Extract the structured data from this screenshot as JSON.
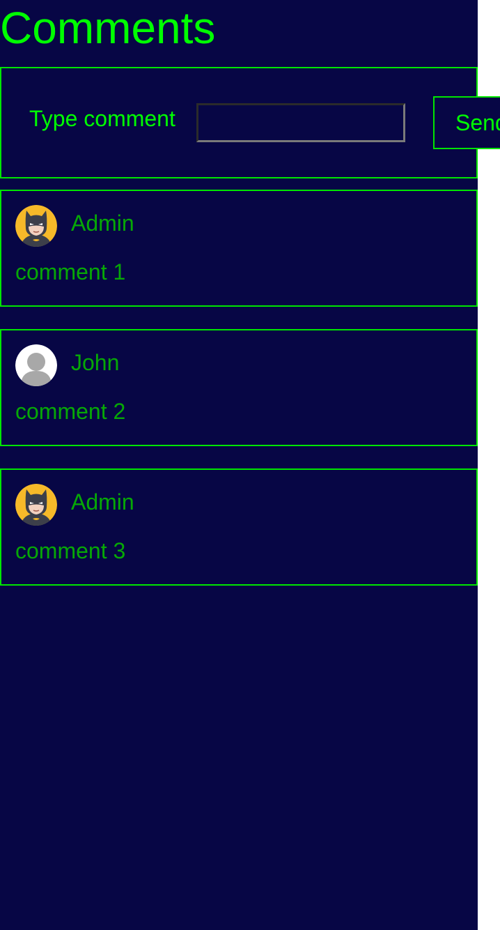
{
  "page": {
    "title": "Comments"
  },
  "composer": {
    "label": "Type comment",
    "input_value": "",
    "input_placeholder": "",
    "send_label": "Send"
  },
  "comments": [
    {
      "author": "Admin",
      "avatar": "batman-avatar-icon",
      "text": "comment 1"
    },
    {
      "author": "John",
      "avatar": "default-user-avatar-icon",
      "text": "comment 2"
    },
    {
      "author": "Admin",
      "avatar": "batman-avatar-icon",
      "text": "comment 3"
    }
  ],
  "colors": {
    "background": "#070645",
    "accent": "#00ff00",
    "border": "#00e600",
    "comment_text": "#06a806"
  }
}
